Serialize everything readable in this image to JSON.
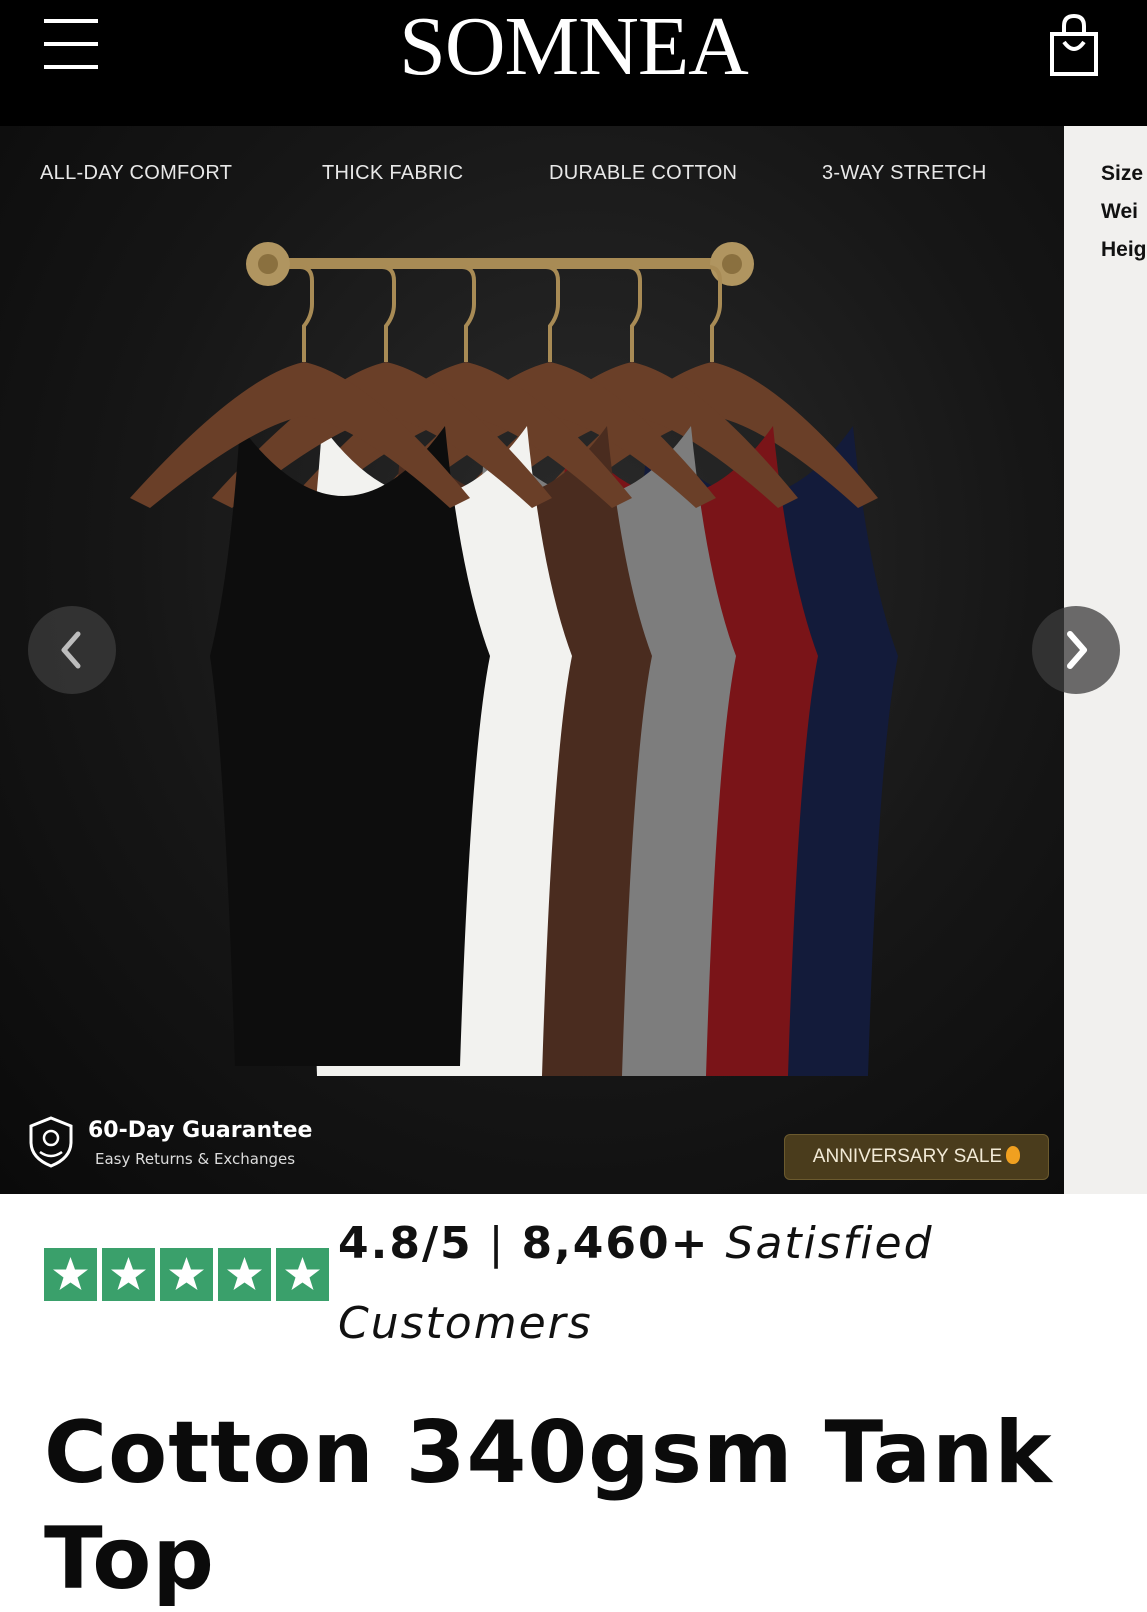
{
  "header": {
    "brand": "SOMNEA",
    "menu_icon": "hamburger-menu-icon",
    "cart_icon": "shopping-bag-icon"
  },
  "carousel": {
    "features": [
      "ALL-DAY COMFORT",
      "THICK FABRIC",
      "DURABLE COTTON",
      "3-WAY STRETCH"
    ],
    "next_slide_specs": [
      "Size",
      "Wei",
      "Heig"
    ],
    "prev_icon": "chevron-left-icon",
    "next_icon": "chevron-right-icon",
    "guarantee": {
      "title": "60-Day Guarantee",
      "subtitle": "Easy Returns & Exchanges",
      "icon": "shield-badge-icon"
    },
    "sale_badge": "ANNIVERSARY SALE",
    "tank_colors": [
      "#0d0d0d",
      "#f2f2ef",
      "#4a2c1f",
      "#7d7d7d",
      "#7a1418",
      "#131b3a"
    ]
  },
  "rating": {
    "score": "4.8/5",
    "separator": "|",
    "count": "8,460+",
    "label_1": "Satisfied",
    "label_2": "Customers",
    "stars": 5,
    "star_color": "#3aa06b"
  },
  "product": {
    "title_line1": "Cotton 340gsm Tank",
    "title_line2": "Top"
  }
}
